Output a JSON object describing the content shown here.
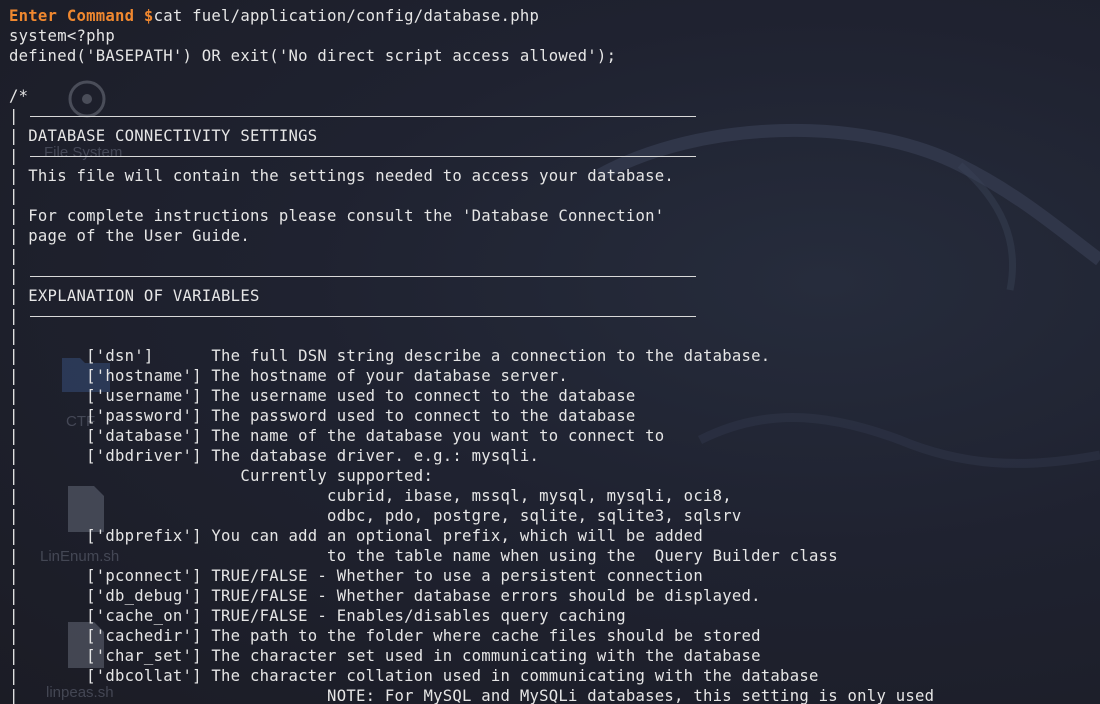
{
  "terminal": {
    "prompt": "Enter Command $",
    "command": "cat fuel/application/config/database.php",
    "lines": [
      "system<?php",
      "defined('BASEPATH') OR exit('No direct script access allowed');",
      "",
      "/*",
      "|",
      "| DATABASE CONNECTIVITY SETTINGS",
      "|",
      "| This file will contain the settings needed to access your database.",
      "|",
      "| For complete instructions please consult the 'Database Connection'",
      "| page of the User Guide.",
      "|",
      "|",
      "| EXPLANATION OF VARIABLES",
      "|",
      "|",
      "|       ['dsn']      The full DSN string describe a connection to the database.",
      "|       ['hostname'] The hostname of your database server.",
      "|       ['username'] The username used to connect to the database",
      "|       ['password'] The password used to connect to the database",
      "|       ['database'] The name of the database you want to connect to",
      "|       ['dbdriver'] The database driver. e.g.: mysqli.",
      "|                       Currently supported:",
      "|                                cubrid, ibase, mssql, mysql, mysqli, oci8,",
      "|                                odbc, pdo, postgre, sqlite, sqlite3, sqlsrv",
      "|       ['dbprefix'] You can add an optional prefix, which will be added",
      "|                                to the table name when using the  Query Builder class",
      "|       ['pconnect'] TRUE/FALSE - Whether to use a persistent connection",
      "|       ['db_debug'] TRUE/FALSE - Whether database errors should be displayed.",
      "|       ['cache_on'] TRUE/FALSE - Enables/disables query caching",
      "|       ['cachedir'] The path to the folder where cache files should be stored",
      "|       ['char_set'] The character set used in communicating with the database",
      "|       ['dbcollat'] The character collation used in communicating with the database",
      "|                                NOTE: For MySQL and MySQLi databases, this setting is only used"
    ]
  },
  "desktop": {
    "icons": [
      {
        "label": "File System",
        "icon": "disc-icon"
      },
      {
        "label": "CTF",
        "icon": "folder-icon"
      },
      {
        "label": "LinEnum.sh",
        "icon": "script-file-icon"
      },
      {
        "label": "linpeas.sh",
        "icon": "script-file-icon"
      }
    ]
  },
  "colors": {
    "background": "#1e1f29",
    "prompt": "#f0882f",
    "text": "#e6e6e6"
  }
}
